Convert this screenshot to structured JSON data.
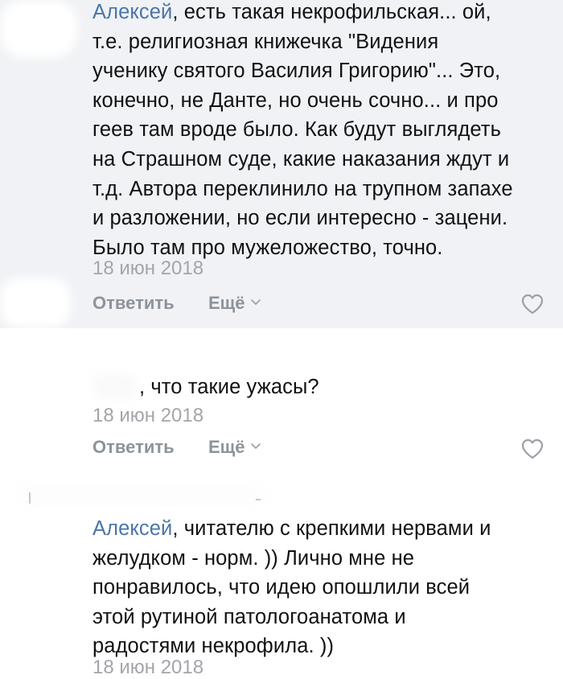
{
  "comments": [
    {
      "author": "Алексей",
      "lines": [
        ", есть такая некрофильская... ой,",
        "т.е. религиозная книжечка \"Видения",
        "ученику святого Василия Григорию\"... Это,",
        "конечно, не Данте, но очень сочно... и про",
        "геев там вроде было. Как будут выглядеть",
        "на Страшном суде, какие наказания ждут и",
        "т.д. Автора переклинило на трупном запахе",
        "и разложении, но если интересно - зацени.",
        "Было там про мужеложество, точно."
      ],
      "date": "18 июн 2018",
      "reply_label": "Ответить",
      "more_label": "Ещё"
    },
    {
      "author": "",
      "lines": [
        ", что такие ужасы?"
      ],
      "date": "18 июн 2018",
      "reply_label": "Ответить",
      "more_label": "Ещё"
    },
    {
      "author": "Алексей",
      "lines": [
        ", читателю с крепкими нервами и",
        "желудком - норм. )) Лично мне не",
        "понравилось, что идею опошлили всей",
        "этой рутиной патологоанатома и",
        "радостями некрофила. ))"
      ],
      "date": "18 июн 2018"
    }
  ],
  "colors": {
    "highlight_bg": "#f0f2f5",
    "author": "#4a76a8",
    "meta": "#a2a5aa",
    "action": "#8d939b",
    "icon": "#9aa0a6"
  },
  "icons": {
    "more": "chevron-down-icon",
    "like": "heart-outline-icon"
  }
}
